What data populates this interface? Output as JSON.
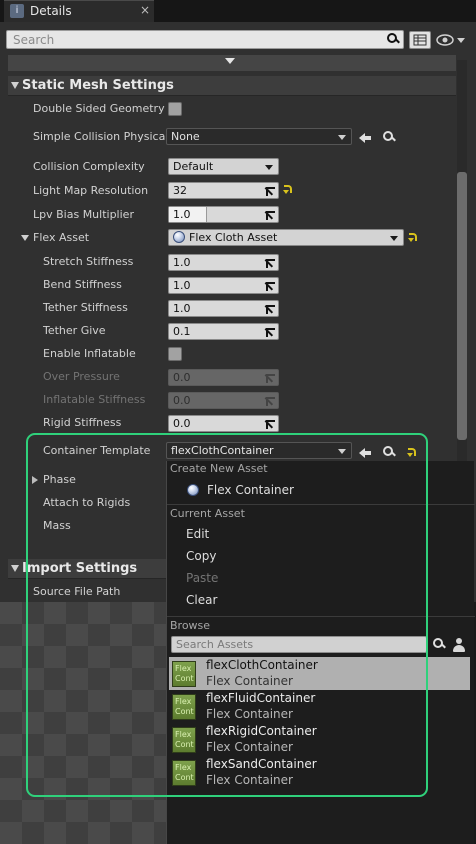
{
  "tab": {
    "icon": "details-icon",
    "label": "Details",
    "close": "×"
  },
  "search": {
    "placeholder": "Search"
  },
  "sections": {
    "static_mesh": "Static Mesh Settings",
    "import": "Import Settings"
  },
  "properties": {
    "double_sided": {
      "label": "Double Sided Geometry",
      "checked": false
    },
    "simple_collision": {
      "label": "Simple Collision Physical",
      "value": "None"
    },
    "collision_complexity": {
      "label": "Collision Complexity",
      "value": "Default"
    },
    "light_map_resolution": {
      "label": "Light Map Resolution",
      "value": "32"
    },
    "lpv_bias": {
      "label": "Lpv Bias Multiplier",
      "value": "1.0",
      "fill_fraction": 0.35
    },
    "flex_asset": {
      "label": "Flex Asset",
      "value": "Flex Cloth Asset"
    },
    "stretch_stiffness": {
      "label": "Stretch Stiffness",
      "value": "1.0"
    },
    "bend_stiffness": {
      "label": "Bend Stiffness",
      "value": "1.0"
    },
    "tether_stiffness": {
      "label": "Tether Stiffness",
      "value": "1.0"
    },
    "tether_give": {
      "label": "Tether Give",
      "value": "0.1"
    },
    "enable_inflatable": {
      "label": "Enable Inflatable",
      "checked": false
    },
    "over_pressure": {
      "label": "Over Pressure",
      "value": "0.0"
    },
    "inflatable_stiffness": {
      "label": "Inflatable Stiffness",
      "value": "0.0"
    },
    "rigid_stiffness": {
      "label": "Rigid Stiffness",
      "value": "0.0"
    },
    "container_template": {
      "label": "Container Template",
      "value": "flexClothContainer"
    },
    "phase": {
      "label": "Phase"
    },
    "attach_to_rigids": {
      "label": "Attach to Rigids"
    },
    "mass": {
      "label": "Mass"
    },
    "source_file_path": {
      "label": "Source File Path"
    }
  },
  "menu": {
    "create_header": "Create New Asset",
    "create_item": "Flex Container",
    "current_header": "Current Asset",
    "edit": "Edit",
    "copy": "Copy",
    "paste": "Paste",
    "clear": "Clear",
    "browse_header": "Browse",
    "search_placeholder": "Search Assets",
    "assets": [
      {
        "thumb": "Flex Cont",
        "name": "flexClothContainer",
        "type": "Flex Container",
        "selected": true
      },
      {
        "thumb": "Flex Cont",
        "name": "flexFluidContainer",
        "type": "Flex Container",
        "selected": false
      },
      {
        "thumb": "Flex Cont",
        "name": "flexRigidContainer",
        "type": "Flex Container",
        "selected": false
      },
      {
        "thumb": "Flex Cont",
        "name": "flexSandContainer",
        "type": "Flex Container",
        "selected": false
      }
    ]
  },
  "colors": {
    "highlight": "#2fd17b",
    "reset_arrow": "#d8c21c",
    "selected_row": "#b0b0b0",
    "panel": "#303030"
  }
}
